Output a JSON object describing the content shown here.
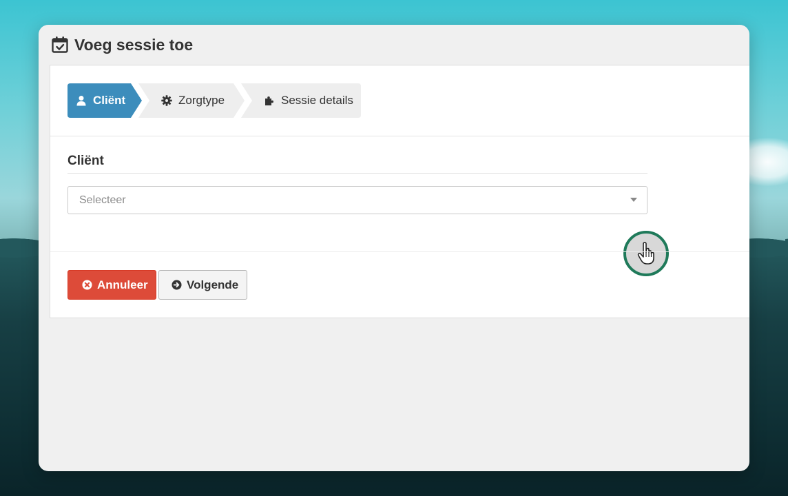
{
  "dialog": {
    "title": "Voeg sessie toe"
  },
  "wizard": {
    "steps": [
      {
        "label": "Cliënt",
        "icon": "user-icon",
        "active": true
      },
      {
        "label": "Zorgtype",
        "icon": "gear-icon",
        "active": false
      },
      {
        "label": "Sessie details",
        "icon": "puzzle-icon",
        "active": false
      }
    ]
  },
  "form": {
    "client_label": "Cliënt",
    "client_select_placeholder": "Selecteer"
  },
  "buttons": {
    "cancel_label": "Annuleer",
    "next_label": "Volgende"
  },
  "colors": {
    "active_step": "#3c8dbc",
    "inactive_step": "#eeeeee",
    "cancel_button": "#dd4b39",
    "cursor_ring": "#1f7a5a"
  }
}
